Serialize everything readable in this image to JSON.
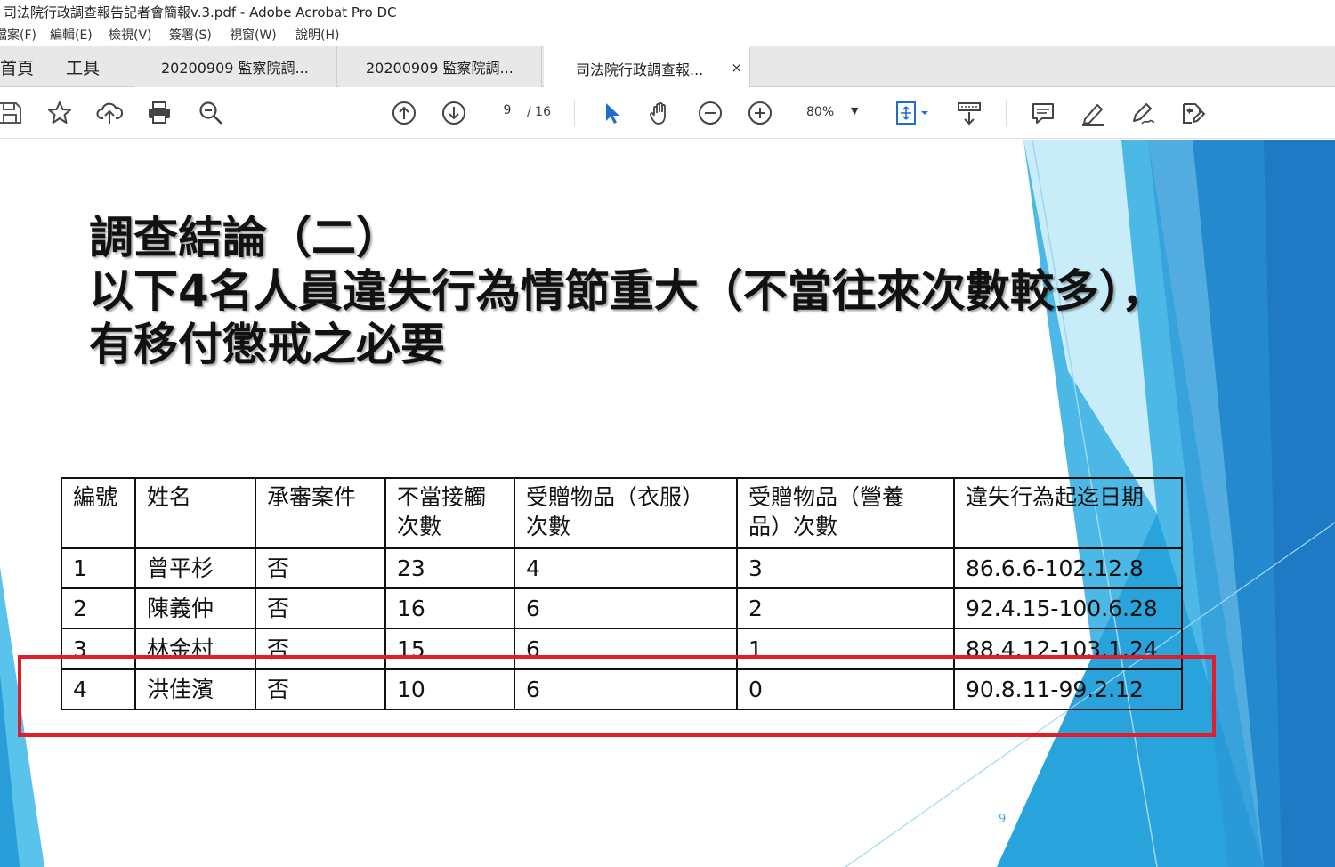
{
  "window": {
    "title": "司法院行政調查報告記者會簡報v.3.pdf - Adobe Acrobat Pro DC"
  },
  "menu": [
    "檔案(F)",
    "編輯(E)",
    "檢視(V)",
    "簽署(S)",
    "視窗(W)",
    "說明(H)"
  ],
  "tabs": {
    "home": "首頁",
    "tools": "工具",
    "docs": [
      "20200909 監察院調...",
      "20200909 監察院調...",
      "司法院行政調查報...",
      "×"
    ]
  },
  "toolbar": {
    "page_current": "9",
    "page_total": "/ 16",
    "zoom": "80%"
  },
  "slide": {
    "title_lines": [
      "調查結論（二）",
      "以下4名人員違失行為情節重大（不當往來次數較多），",
      "有移付懲戒之必要"
    ],
    "table": {
      "headers": [
        "編號",
        "姓名",
        "承審案件",
        "不當接觸次數",
        "受贈物品（衣服）次數",
        "受贈物品（營養品）次數",
        "違失行為起迄日期"
      ],
      "headers_display": [
        [
          "編號"
        ],
        [
          "姓名"
        ],
        [
          "承審案件"
        ],
        [
          "不當接觸",
          "次數"
        ],
        [
          "受贈物品（衣服）",
          "次數"
        ],
        [
          "受贈物品（營養",
          "品）次數"
        ],
        [
          "違失行為起迄日期"
        ]
      ],
      "rows": [
        [
          "1",
          "曾平杉",
          "否",
          "23",
          "4",
          "3",
          "86.6.6-102.12.8"
        ],
        [
          "2",
          "陳義仲",
          "否",
          "16",
          "6",
          "2",
          "92.4.15-100.6.28"
        ],
        [
          "3",
          "林金村",
          "否",
          "15",
          "6",
          "1",
          "88.4.12-103.1.24"
        ],
        [
          "4",
          "洪佳濱",
          "否",
          "10",
          "6",
          "0",
          "90.8.11-99.2.12"
        ]
      ]
    },
    "page_number": "9"
  },
  "colors": {
    "highlight": "#e01e2a",
    "accent_blue": "#1e7ac4"
  }
}
